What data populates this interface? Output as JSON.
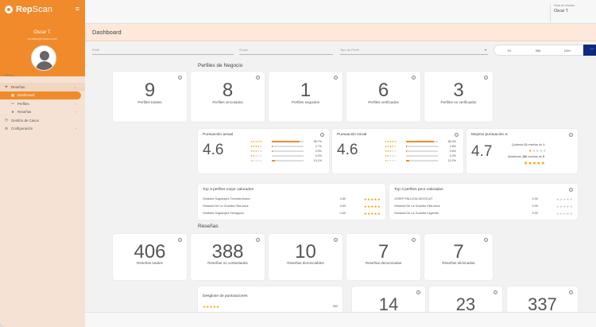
{
  "brand": {
    "name_bold": "Rep",
    "name_light": "Scan"
  },
  "user": {
    "name": "Oscar T.",
    "email": "oscarsan@repscan.com"
  },
  "sidebar": {
    "menu_label": "MENÚ",
    "items": [
      {
        "label": "Reseñas",
        "icon": "star-icon",
        "chev": "⌄"
      },
      {
        "label": "Dashboard",
        "icon": "grid-icon",
        "chev": ""
      },
      {
        "label": "Perfiles",
        "icon": "id-card-icon",
        "chev": "›"
      },
      {
        "label": "Reseñas",
        "icon": "star-icon",
        "chev": "›"
      },
      {
        "label": "Gestión de Casos",
        "icon": "clock-icon",
        "chev": ""
      },
      {
        "label": "Configuración",
        "icon": "gear-icon",
        "chev": "›"
      }
    ]
  },
  "topbar": {
    "login_label": "Vista de Usuario",
    "login_value": "Oscar T."
  },
  "header": {
    "title": "Dashboard"
  },
  "filters": {
    "perfil": "Perfil",
    "grupo": "Grupo",
    "tipo": "Tipo de Perfil",
    "ranges": [
      "7d",
      "30d",
      "12m"
    ],
    "more": "···"
  },
  "business": {
    "title": "Perfiles de Negocio",
    "stats": [
      {
        "value": "9",
        "label": "Perfiles totales"
      },
      {
        "value": "8",
        "label": "Perfiles vinculados"
      },
      {
        "value": "1",
        "label": "Perfiles seguidos"
      },
      {
        "value": "6",
        "label": "Perfiles verificados"
      },
      {
        "value": "3",
        "label": "Perfiles no verificados"
      }
    ],
    "current": {
      "title": "Puntuación actual",
      "value": "4.6",
      "dist": [
        {
          "stars": 5,
          "pct": "86.7%",
          "frac": 0.867
        },
        {
          "stars": 4,
          "pct": "2.7%",
          "frac": 0.027
        },
        {
          "stars": 3,
          "pct": "0.5%",
          "frac": 0.005
        },
        {
          "stars": 2,
          "pct": "0.0%",
          "frac": 0.0
        },
        {
          "stars": 1,
          "pct": "10.1%",
          "frac": 0.101
        }
      ]
    },
    "initial": {
      "title": "Puntuación inicial",
      "value": "4.6",
      "dist": [
        {
          "stars": 5,
          "pct": "86.4%",
          "frac": 0.864
        },
        {
          "stars": 4,
          "pct": "2.8%",
          "frac": 0.028
        },
        {
          "stars": 3,
          "pct": "0.6%",
          "frac": 0.006
        },
        {
          "stars": 2,
          "pct": "0.0%",
          "frac": 0.0
        },
        {
          "stars": 1,
          "pct": "10.2%",
          "frac": 0.102
        }
      ]
    },
    "improve": {
      "title": "Mejorar puntuación a:",
      "value": "4.7",
      "line1_pre": "Quitando",
      "line1_num": "11",
      "line1_mid": "reseñas de",
      "line1_stars": "1",
      "line1_star_count": 1,
      "line2_pre": "Añadiendo",
      "line2_num": "106",
      "line2_mid": "reseñas de",
      "line2_stars": "5",
      "line2_star_count": 5
    },
    "best": {
      "title": "Top 3 perfiles mejor valorados",
      "rows": [
        {
          "name": "Gestoria Sugranyes Torredembarra",
          "score": "4.80",
          "stars": 4.8
        },
        {
          "name": "Gestoria De La Guardia Villa-seca",
          "score": "4.60",
          "stars": 4.6
        },
        {
          "name": "Gestoria Sugranyes Tarragona",
          "score": "4.60",
          "stars": 4.6
        }
      ]
    },
    "worst": {
      "title": "Top 3 perfiles peor valorados",
      "rows": [
        {
          "name": "JOSEP PALLEJÀ ADVOCAT",
          "score": "0.00",
          "stars": 0
        },
        {
          "name": "Gestoria De La Guardia Villa-seca",
          "score": "0.00",
          "stars": 0
        },
        {
          "name": "Gestoria De La Guardia Legends",
          "score": "0.00",
          "stars": 0
        }
      ]
    }
  },
  "reviews": {
    "title": "Reseñas",
    "stats": [
      {
        "value": "406",
        "label": "Reseñas totales"
      },
      {
        "value": "388",
        "label": "Reseñas no contestadas"
      },
      {
        "value": "10",
        "label": "Reseñas denunciables"
      },
      {
        "value": "7",
        "label": "Reseñas denunciadas"
      },
      {
        "value": "7",
        "label": "Reseñas eliminadas"
      }
    ],
    "breakdown": {
      "title": "Desglose de puntuaciones",
      "first_count": "352",
      "first_stars": 5
    },
    "more_stats": [
      "14",
      "23",
      "337"
    ]
  },
  "colors": {
    "accent": "#f18a2a",
    "star": "#f2a20a",
    "navy": "#0f2a7d"
  }
}
